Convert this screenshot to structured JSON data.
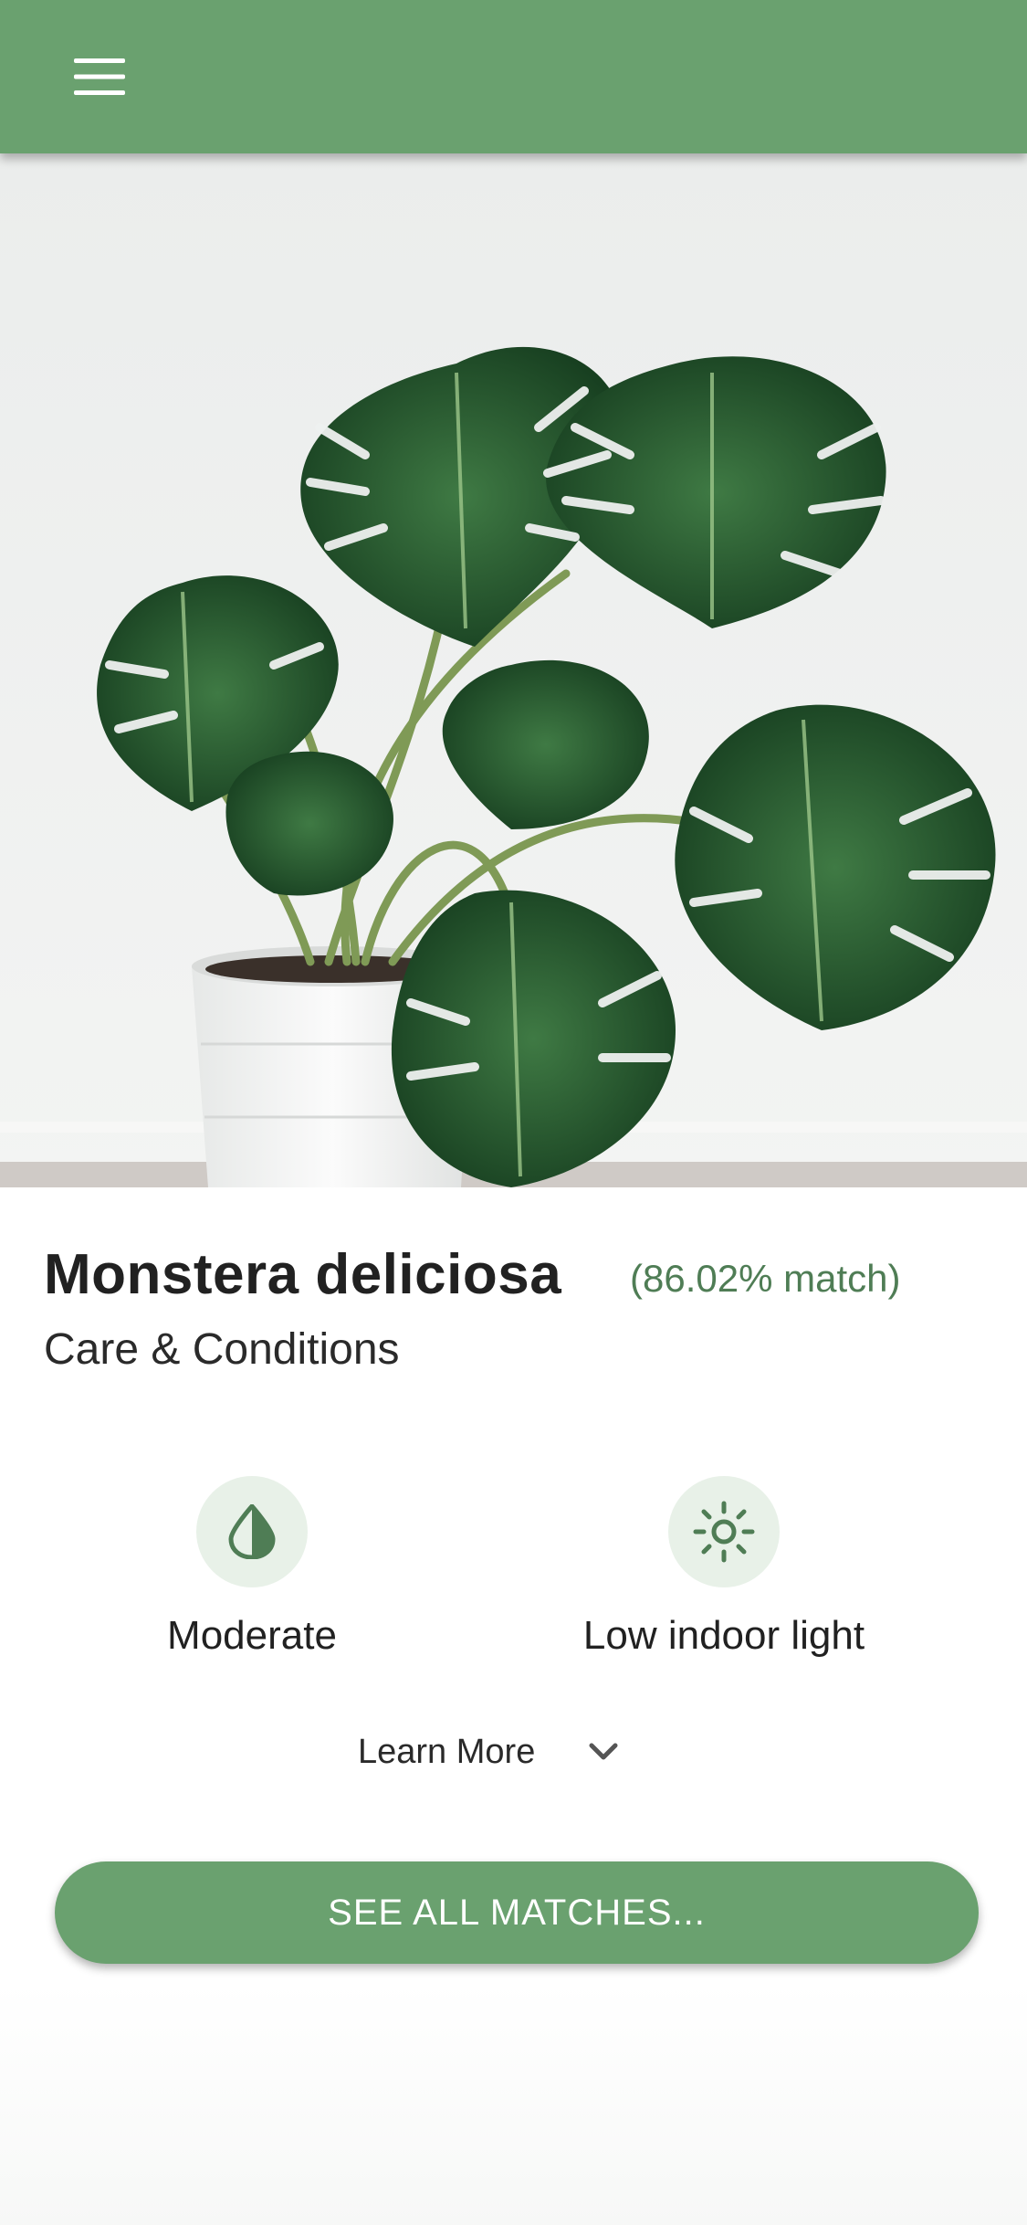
{
  "header": {
    "menu_icon": "hamburger-menu-icon",
    "background_color": "#6aa16f"
  },
  "hero": {
    "image_description_icon": "monstera-plant-photo"
  },
  "result": {
    "plant_name": "Monstera deliciosa",
    "match_text": "(86.02% match)",
    "subtitle": "Care & Conditions"
  },
  "care": {
    "water": {
      "icon": "water-drop-icon",
      "label": "Moderate"
    },
    "light": {
      "icon": "sun-icon",
      "label": "Low indoor light"
    }
  },
  "learn_more": {
    "label": "Learn More",
    "icon": "chevron-down-icon"
  },
  "cta": {
    "label": "SEE ALL MATCHES..."
  },
  "colors": {
    "primary": "#6aa16f",
    "match_text": "#4f7d55",
    "icon_bg": "#e8f1e8",
    "icon_fg": "#4f7d55"
  }
}
